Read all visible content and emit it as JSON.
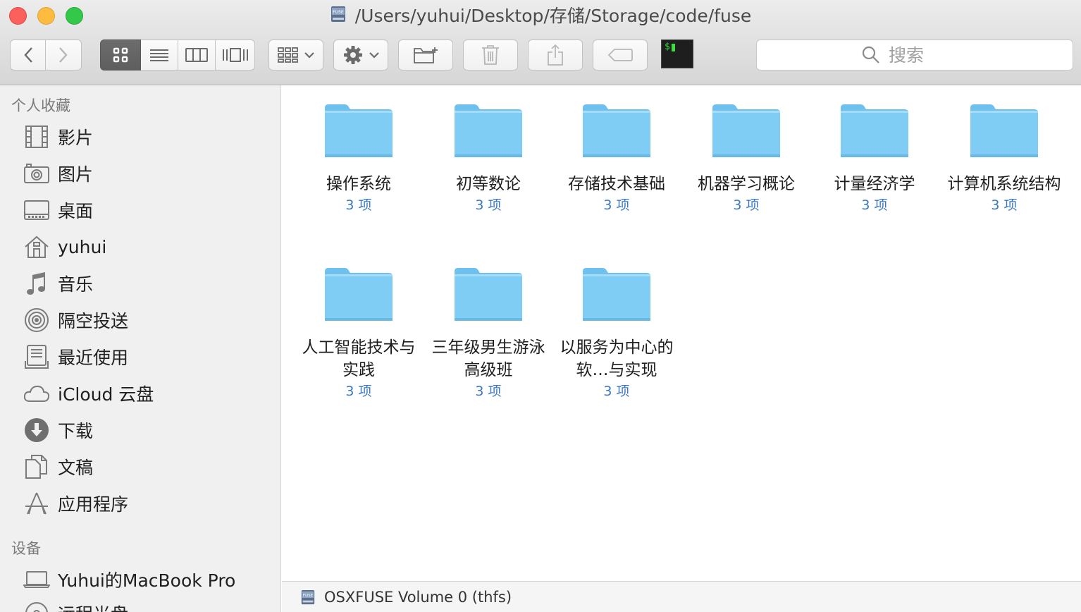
{
  "window": {
    "title": "/Users/yuhui/Desktop/存储/Storage/code/fuse",
    "title_icon": "fuse-volume-icon"
  },
  "toolbar": {
    "buttons": [
      "back",
      "forward",
      "view-icons",
      "view-list",
      "view-columns",
      "view-cover-flow",
      "group-by",
      "action-gear",
      "new-folder",
      "trash",
      "share",
      "tag",
      "terminal"
    ],
    "active_view": "view-icons",
    "terminal_label": "$",
    "search_placeholder": "搜索"
  },
  "sidebar": {
    "favorites_title": "个人收藏",
    "favorites": [
      {
        "label": "影片",
        "icon": "film-icon"
      },
      {
        "label": "图片",
        "icon": "camera-icon"
      },
      {
        "label": "桌面",
        "icon": "desktop-icon"
      },
      {
        "label": "yuhui",
        "icon": "home-icon"
      },
      {
        "label": "音乐",
        "icon": "music-icon"
      },
      {
        "label": "隔空投送",
        "icon": "airdrop-icon"
      },
      {
        "label": "最近使用",
        "icon": "recents-icon"
      },
      {
        "label": "iCloud 云盘",
        "icon": "cloud-icon"
      },
      {
        "label": "下载",
        "icon": "download-icon"
      },
      {
        "label": "文稿",
        "icon": "documents-icon"
      },
      {
        "label": "应用程序",
        "icon": "applications-icon"
      }
    ],
    "devices_title": "设备",
    "devices": [
      {
        "label": "Yuhui的MacBook Pro",
        "icon": "laptop-icon"
      },
      {
        "label": "远程光盘",
        "icon": "disc-icon"
      }
    ]
  },
  "folders": [
    {
      "name": "操作系统",
      "count": "3 项"
    },
    {
      "name": "初等数论",
      "count": "3 项"
    },
    {
      "name": "存储技术基础",
      "count": "3 项"
    },
    {
      "name": "机器学习概论",
      "count": "3 项"
    },
    {
      "name": "计量经济学",
      "count": "3 项"
    },
    {
      "name": "计算机系统结构",
      "count": "3 项"
    },
    {
      "name": "人工智能技术与实践",
      "count": "3 项"
    },
    {
      "name": "三年级男生游泳高级班",
      "count": "3 项"
    },
    {
      "name": "以服务为中心的软…与实现",
      "count": "3 项"
    }
  ],
  "statusbar": {
    "text": "OSXFUSE Volume 0 (thfs)",
    "icon": "fuse-volume-icon"
  },
  "colors": {
    "folder": "#7fccf5",
    "folder_tab": "#6ec0ee",
    "count_text": "#3a78c2",
    "close": "#fc605c",
    "minimize": "#fdbc40",
    "maximize": "#34c84a"
  }
}
